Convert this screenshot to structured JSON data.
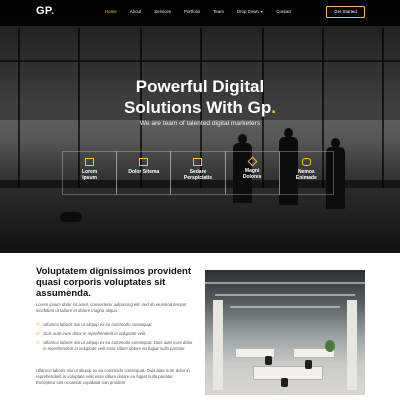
{
  "brand": {
    "name": "GP",
    "dot": "."
  },
  "nav": {
    "items": [
      "Home",
      "About",
      "Services",
      "Portfolio",
      "Team",
      "Drop Down",
      "Contact"
    ],
    "active_index": 0,
    "cta_label": "Get Started"
  },
  "hero": {
    "title_line1": "Powerful Digital",
    "title_line2": "Solutions With Gp",
    "title_dot": ".",
    "subtitle": "We are team of talented digital marketers",
    "boxes": [
      {
        "label": "Lorem\nIpsum",
        "icon": "store-icon"
      },
      {
        "label": "Dolor Sitema",
        "icon": "bar-chart-icon"
      },
      {
        "label": "Sedare\nPerspiciatis",
        "icon": "calendar-icon"
      },
      {
        "label": "Magni\nDolores",
        "icon": "paint-brush-icon"
      },
      {
        "label": "Nemos\nEnimade",
        "icon": "database-icon"
      }
    ]
  },
  "about": {
    "title": "Voluptatem dignissimos provident quasi corporis voluptates sit assumenda.",
    "intro": "Lorem ipsum dolor sit amet, consectetur adipiscing elit, sed do eiusmod tempor incididunt ut labore et dolore magna aliqua.",
    "list": [
      "Ullamco laboris nisi ut aliquip ex ea commodo consequat.",
      "Duis aute irure dolor in reprehenderit in voluptate velit.",
      "Ullamco laboris nisi ut aliquip ex ea commodo consequat. Duis aute irure dolor in reprehenderit in voluptate velit esse cillum dolore eu fugiat nulla pariatur."
    ],
    "outro": "Ullamco laboris nisi ut aliquip ex ea commodo consequat. Duis aute irure dolor in reprehenderit in voluptate velit esse cillum dolore eu fugiat nulla pariatur. Excepteur sint occaecat cupidatat non proident"
  },
  "colors": {
    "accent": "#ffbd2e",
    "dark": "#111111",
    "text_muted": "#555555"
  }
}
